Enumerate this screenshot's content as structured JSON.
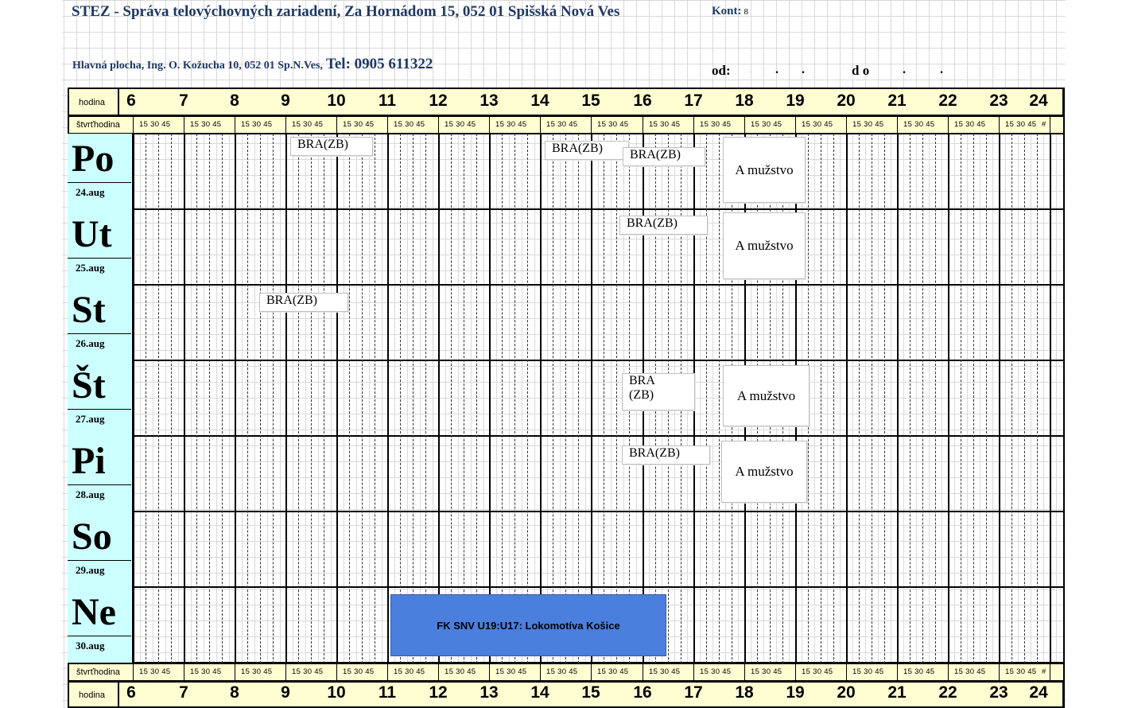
{
  "header": {
    "title": "STEZ - Správa telovýchovných zariadení, Za Hornádom 15, 052 01 Spišská Nová Ves",
    "kont_label": "Kont:",
    "kont_value": "8",
    "subtitle": "Hlavná plocha, Ing. O. Kožucha 10, 052 01 Sp.N.Ves,",
    "tel": "Tel: 0905 611322",
    "od_label": "od:",
    "do_label": "d o",
    "dot": "."
  },
  "grid": {
    "hour_label": "hodina",
    "quarter_label": "štvrťhodina",
    "hours": [
      "6",
      "7",
      "8",
      "9",
      "10",
      "11",
      "12",
      "13",
      "14",
      "15",
      "16",
      "17",
      "18",
      "19",
      "20",
      "21",
      "22",
      "23",
      "24"
    ],
    "quarters": "15  30  45",
    "last_quarter": "#"
  },
  "days": [
    {
      "name": "Po",
      "date": "24.aug"
    },
    {
      "name": "Ut",
      "date": "25.aug"
    },
    {
      "name": "St",
      "date": "26.aug"
    },
    {
      "name": "Št",
      "date": "27.aug"
    },
    {
      "name": "Pi",
      "date": "28.aug"
    },
    {
      "name": "So",
      "date": "29.aug"
    },
    {
      "name": "Ne",
      "date": "30.aug"
    }
  ],
  "bookings": {
    "bra": "BRA(ZB)",
    "bra_line1": "BRA",
    "bra_line2": "(ZB)",
    "team": "A mužstvo",
    "match": "FK SNV U19:U17: Lokomotíva Košice"
  }
}
